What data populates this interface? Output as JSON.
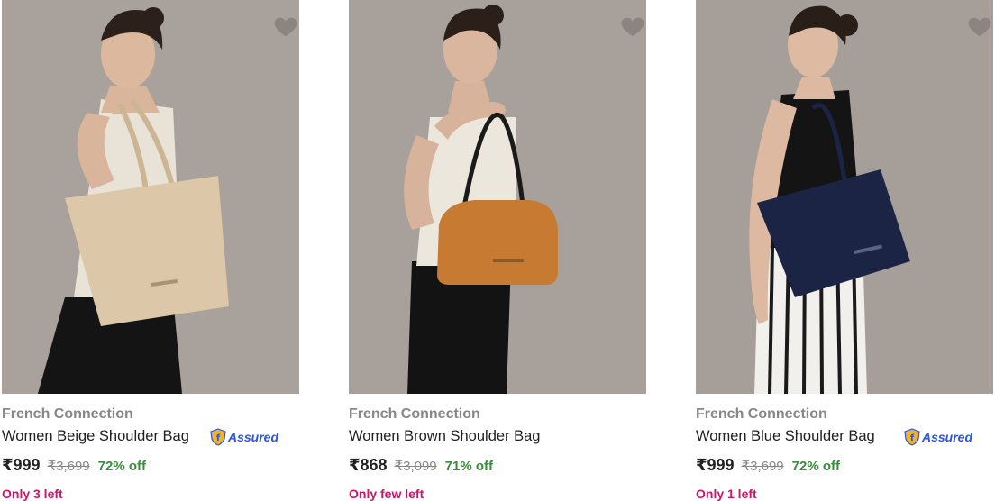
{
  "products": [
    {
      "brand": "French Connection",
      "title": "Women Beige Shoulder Bag",
      "price": "₹999",
      "mrp": "₹3,699",
      "discount": "72% off",
      "stock": "Only 3 left",
      "assured": true,
      "assured_label": "Assured",
      "bag_color": "#dcc8a8"
    },
    {
      "brand": "French Connection",
      "title": "Women Brown Shoulder Bag",
      "price": "₹868",
      "mrp": "₹3,099",
      "discount": "71% off",
      "stock": "Only few left",
      "assured": false,
      "bag_color": "#c77a32"
    },
    {
      "brand": "French Connection",
      "title": "Women Blue Shoulder Bag",
      "price": "₹999",
      "mrp": "₹3,699",
      "discount": "72% off",
      "stock": "Only 1 left",
      "assured": true,
      "assured_label": "Assured",
      "bag_color": "#1c2446"
    }
  ],
  "icons": {
    "wishlist": "heart-icon",
    "assured": "assured-shield-icon"
  },
  "colors": {
    "image_bg": "#a7a09a",
    "price_green": "#388e3c",
    "stock_pink": "#c9166c",
    "assured_blue": "#2a55e5"
  }
}
